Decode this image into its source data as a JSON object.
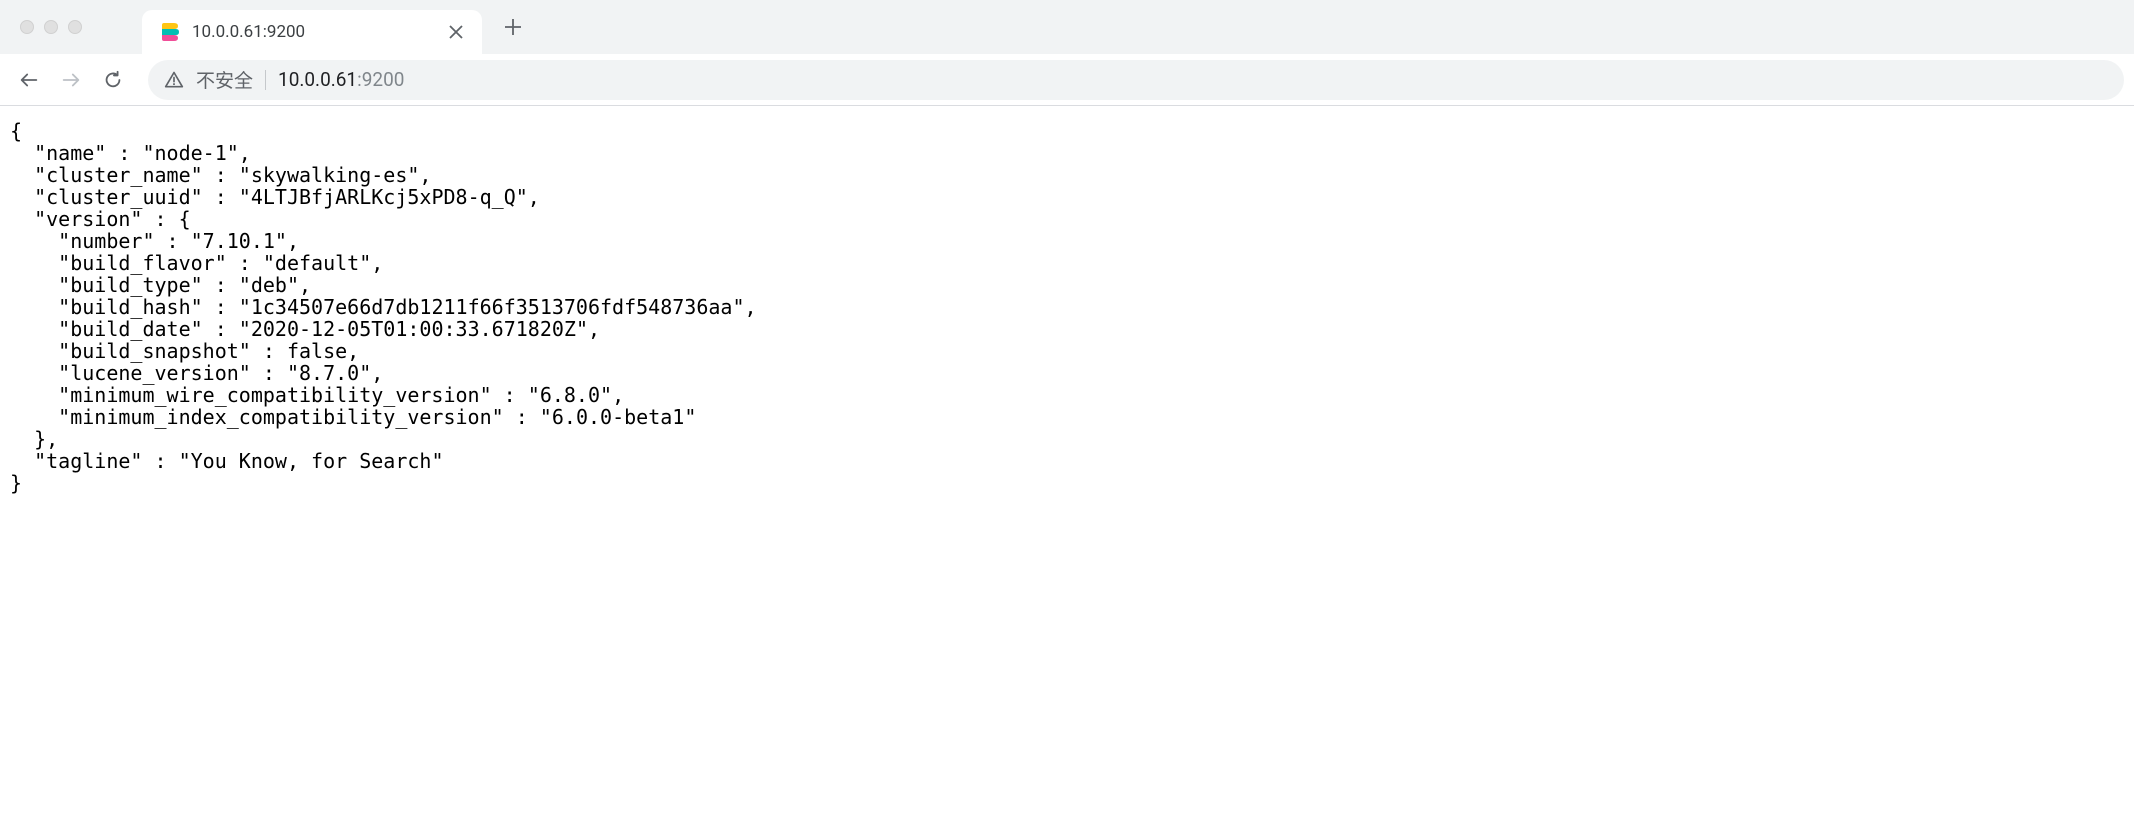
{
  "tab": {
    "title": "10.0.0.61:9200"
  },
  "toolbar": {
    "insecure_label": "不安全",
    "url_host": "10.0.0.61",
    "url_port": ":9200"
  },
  "response": {
    "name": "node-1",
    "cluster_name": "skywalking-es",
    "cluster_uuid": "4LTJBfjARLKcj5xPD8-q_Q",
    "version": {
      "number": "7.10.1",
      "build_flavor": "default",
      "build_type": "deb",
      "build_hash": "1c34507e66d7db1211f66f3513706fdf548736aa",
      "build_date": "2020-12-05T01:00:33.671820Z",
      "build_snapshot": "false",
      "lucene_version": "8.7.0",
      "minimum_wire_compatibility_version": "6.8.0",
      "minimum_index_compatibility_version": "6.0.0-beta1"
    },
    "tagline": "You Know, for Search"
  }
}
